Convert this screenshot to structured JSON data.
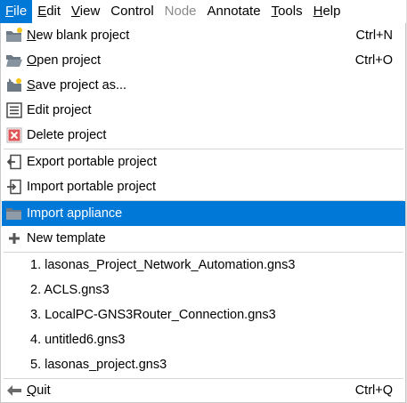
{
  "menubar": {
    "items": [
      {
        "label": "File",
        "state": "active"
      },
      {
        "label": "Edit",
        "state": "normal"
      },
      {
        "label": "View",
        "state": "normal"
      },
      {
        "label": "Control",
        "state": "normal"
      },
      {
        "label": "Node",
        "state": "disabled"
      },
      {
        "label": "Annotate",
        "state": "normal"
      },
      {
        "label": "Tools",
        "state": "normal"
      },
      {
        "label": "Help",
        "state": "normal"
      }
    ]
  },
  "file_menu": {
    "items": [
      {
        "label": "New blank project",
        "shortcut": "Ctrl+N",
        "icon": "new-folder-icon"
      },
      {
        "label": "Open project",
        "shortcut": "Ctrl+O",
        "icon": "open-folder-icon"
      },
      {
        "label": "Save project as...",
        "shortcut": "",
        "icon": "save-as-icon"
      },
      {
        "label": "Edit project",
        "shortcut": "",
        "icon": "list-icon"
      },
      {
        "label": "Delete project",
        "shortcut": "",
        "icon": "delete-icon"
      },
      {
        "label": "Export portable project",
        "shortcut": "",
        "icon": "export-icon"
      },
      {
        "label": "Import portable project",
        "shortcut": "",
        "icon": "import-icon"
      },
      {
        "label": "Import appliance",
        "shortcut": "",
        "icon": "folder-icon",
        "highlighted": true
      },
      {
        "label": "New template",
        "shortcut": "",
        "icon": "plus-icon"
      }
    ],
    "recent_projects": [
      "1. lasonas_Project_Network_Automation.gns3",
      "2. ACLS.gns3",
      "3. LocalPC-GNS3Router_Connection.gns3",
      "4. untitled6.gns3",
      "5. lasonas_project.gns3"
    ],
    "quit": {
      "label": "Quit",
      "shortcut": "Ctrl+Q",
      "icon": "quit-arrow-icon"
    }
  },
  "colors": {
    "highlight": "#0078d7",
    "disabled_text": "#8a8a8a",
    "separator": "#d5d5d5"
  }
}
